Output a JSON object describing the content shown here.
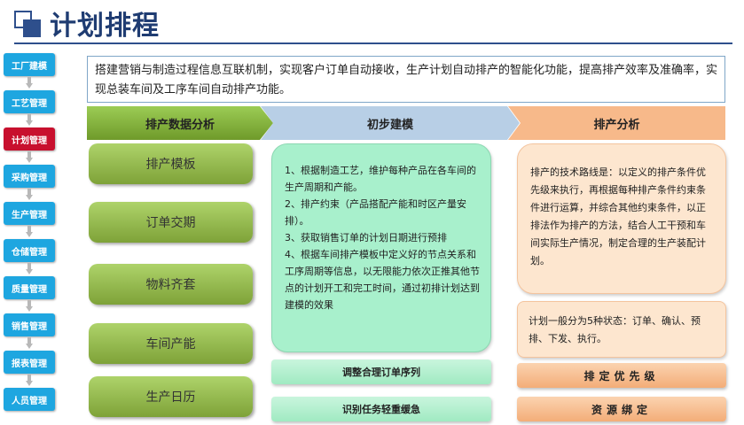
{
  "title": "计划排程",
  "sidebar": {
    "items": [
      {
        "label": "工厂建模",
        "active": false
      },
      {
        "label": "工艺管理",
        "active": false
      },
      {
        "label": "计划管理",
        "active": true
      },
      {
        "label": "采购管理",
        "active": false
      },
      {
        "label": "生产管理",
        "active": false
      },
      {
        "label": "仓储管理",
        "active": false
      },
      {
        "label": "质量管理",
        "active": false
      },
      {
        "label": "销售管理",
        "active": false
      },
      {
        "label": "报表管理",
        "active": false
      },
      {
        "label": "人员管理",
        "active": false
      }
    ]
  },
  "description": "搭建营销与制造过程信息互联机制，实现客户订单自动接收，生产计划自动排产的智能化功能，提高排产效率及准确率，实现总装车间及工序车间自动排产功能。",
  "columns": {
    "left": {
      "header": "排产数据分析",
      "items": [
        "排产模板",
        "订单交期",
        "物料齐套",
        "车间产能",
        "生产日历"
      ]
    },
    "middle": {
      "header": "初步建模",
      "lines": [
        "1、根据制造工艺，维护每种产品在各车间的生产周期和产能。",
        "2、排产约束（产品搭配产能和时区产量安排）。",
        "3、获取销售订单的计划日期进行预排",
        "4、根据车间排产模板中定义好的节点关系和工序周期等信息，以无限能力依次正推其他节点的计划开工和完工时间，通过初排计划达到建模的效果"
      ],
      "bars": [
        "调整合理订单序列",
        "识别任务轻重缓急"
      ]
    },
    "right": {
      "header": "排产分析",
      "text": "排产的技术路线是：以定义的排产条件优先级来执行，再根据每种排产条件约束条件进行运算，并综合其他约束条件，以正排法作为排产的方法，结合人工干预和车间实际生产情况，制定合理的生产装配计划。",
      "status_text": "计划一般分为5种状态：订单、确认、预排、下发、执行。",
      "bars": [
        "排定优先级",
        "资源绑定"
      ]
    }
  },
  "colors": {
    "title": "#1f3c72",
    "sidebar_default": "#1ea6e0",
    "sidebar_active": "#c8102e",
    "green": "#8cb84a",
    "mint": "#a8f0cc",
    "peach": "#fde6cf",
    "orange": "#f7b98a",
    "blue_header": "#b8cfe6"
  }
}
